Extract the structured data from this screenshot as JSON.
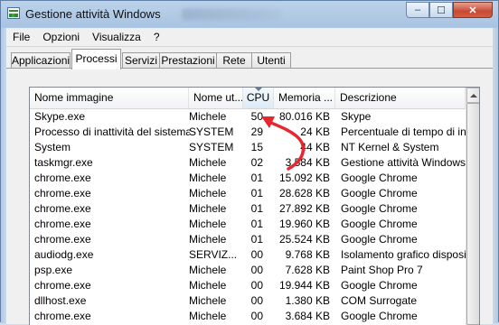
{
  "window": {
    "title": "Gestione attività Windows",
    "caption_buttons": {
      "minimize": "–",
      "maximize": "☐",
      "close": "✕"
    }
  },
  "menubar": {
    "items": [
      "File",
      "Opzioni",
      "Visualizza",
      "?"
    ]
  },
  "tabs": [
    {
      "label": "Applicazioni",
      "active": false
    },
    {
      "label": "Processi",
      "active": true
    },
    {
      "label": "Servizi",
      "active": false
    },
    {
      "label": "Prestazioni",
      "active": false
    },
    {
      "label": "Rete",
      "active": false
    },
    {
      "label": "Utenti",
      "active": false
    }
  ],
  "process_list": {
    "columns": [
      "Nome immagine",
      "Nome ut...",
      "CPU",
      "Memoria ...",
      "Descrizione"
    ],
    "sorted_column": "CPU",
    "rows": [
      [
        "Skype.exe",
        "Michele",
        "50",
        "80.016 KB",
        "Skype"
      ],
      [
        "Processo di inattività del sistema",
        "SYSTEM",
        "29",
        "24 KB",
        "Percentuale di tempo di ina"
      ],
      [
        "System",
        "SYSTEM",
        "15",
        "44 KB",
        "NT Kernel & System"
      ],
      [
        "taskmgr.exe",
        "Michele",
        "02",
        "3.584 KB",
        "Gestione attività Windows"
      ],
      [
        "chrome.exe",
        "Michele",
        "01",
        "15.092 KB",
        "Google Chrome"
      ],
      [
        "chrome.exe",
        "Michele",
        "01",
        "28.628 KB",
        "Google Chrome"
      ],
      [
        "chrome.exe",
        "Michele",
        "01",
        "27.892 KB",
        "Google Chrome"
      ],
      [
        "chrome.exe",
        "Michele",
        "01",
        "19.960 KB",
        "Google Chrome"
      ],
      [
        "chrome.exe",
        "Michele",
        "01",
        "25.524 KB",
        "Google Chrome"
      ],
      [
        "audiodg.exe",
        "SERVIZ...",
        "00",
        "9.768 KB",
        "Isolamento grafico disposit"
      ],
      [
        "psp.exe",
        "Michele",
        "00",
        "7.628 KB",
        "Paint Shop Pro 7"
      ],
      [
        "chrome.exe",
        "Michele",
        "00",
        "19.944 KB",
        "Google Chrome"
      ],
      [
        "dllhost.exe",
        "Michele",
        "00",
        "1.380 KB",
        "COM Surrogate"
      ],
      [
        "chrome.exe",
        "Michele",
        "00",
        "3.684 KB",
        "Google Chrome"
      ]
    ]
  },
  "annotation": {
    "color": "#e8262d"
  }
}
